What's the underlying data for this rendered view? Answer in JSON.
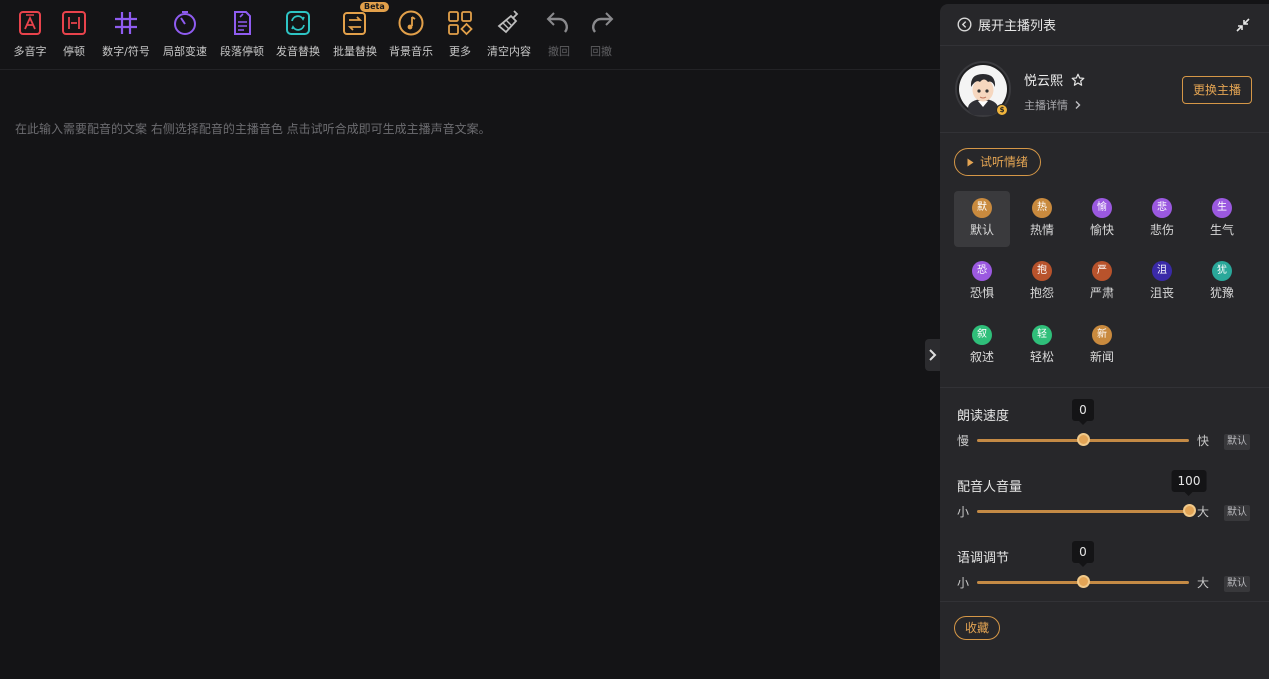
{
  "toolbar": {
    "tools": [
      {
        "label": "多音字",
        "icon": "polyphone-icon",
        "color": "#e8434c"
      },
      {
        "label": "停顿",
        "icon": "pause-icon",
        "color": "#e8434c"
      },
      {
        "label": "数字/符号",
        "icon": "hash-icon",
        "color": "#8f5cf0"
      },
      {
        "label": "局部变速",
        "icon": "speed-icon",
        "color": "#8f5cf0"
      },
      {
        "label": "段落停顿",
        "icon": "paragraph-pause-icon",
        "color": "#8f5cf0"
      },
      {
        "label": "发音替换",
        "icon": "pronunciation-replace-icon",
        "color": "#2ec4c4"
      },
      {
        "label": "批量替换",
        "icon": "batch-replace-icon",
        "color": "#e2a04a",
        "badge": "Beta"
      },
      {
        "label": "背景音乐",
        "icon": "music-icon",
        "color": "#e2a04a"
      },
      {
        "label": "更多",
        "icon": "more-grid-icon",
        "color": "#e2a04a"
      },
      {
        "label": "清空内容",
        "icon": "broom-icon",
        "color": "#bdbdbd"
      },
      {
        "label": "撤回",
        "icon": "undo-icon",
        "color": "#8a8a8d"
      },
      {
        "label": "回撤",
        "icon": "redo-icon",
        "color": "#8a8a8d"
      }
    ]
  },
  "editor": {
    "placeholder": "在此输入需要配音的文案 右侧选择配音的主播音色 点击试听合成即可生成主播声音文案。"
  },
  "panel": {
    "header_title": "展开主播列表",
    "anchor": {
      "name": "悦云熙",
      "detail_label": "主播详情",
      "change_label": "更换主播"
    },
    "preview_label": "试听情绪",
    "emotions": [
      {
        "badge": "默",
        "name": "默认",
        "color": "#c98a3e",
        "active": true
      },
      {
        "badge": "热",
        "name": "热情",
        "color": "#c98a3e"
      },
      {
        "badge": "愉",
        "name": "愉快",
        "color": "#9b59e0"
      },
      {
        "badge": "悲",
        "name": "悲伤",
        "color": "#9b59e0"
      },
      {
        "badge": "生",
        "name": "生气",
        "color": "#9b59e0"
      },
      {
        "badge": "恐",
        "name": "恐惧",
        "color": "#9b59e0"
      },
      {
        "badge": "抱",
        "name": "抱怨",
        "color": "#b8532c"
      },
      {
        "badge": "严",
        "name": "严肃",
        "color": "#b8532c"
      },
      {
        "badge": "沮",
        "name": "沮丧",
        "color": "#3a2aa8"
      },
      {
        "badge": "犹",
        "name": "犹豫",
        "color": "#2aa89a"
      },
      {
        "badge": "叙",
        "name": "叙述",
        "color": "#2fbf7a"
      },
      {
        "badge": "轻",
        "name": "轻松",
        "color": "#2fbf7a"
      },
      {
        "badge": "新",
        "name": "新闻",
        "color": "#c98a3e"
      }
    ],
    "sliders": [
      {
        "title": "朗读速度",
        "min_label": "慢",
        "max_label": "快",
        "value": "0",
        "fraction": 0.5,
        "default_label": "默认"
      },
      {
        "title": "配音人音量",
        "min_label": "小",
        "max_label": "大",
        "value": "100",
        "fraction": 1.0,
        "default_label": "默认"
      },
      {
        "title": "语调调节",
        "min_label": "小",
        "max_label": "大",
        "value": "0",
        "fraction": 0.5,
        "default_label": "默认"
      }
    ],
    "collect_label": "收藏"
  }
}
